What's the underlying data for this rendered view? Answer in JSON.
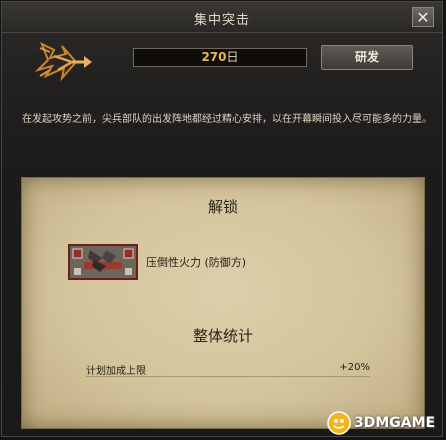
{
  "window": {
    "title": "集中突击"
  },
  "header": {
    "duration_value": "270",
    "duration_unit": "日",
    "research_label": "研发"
  },
  "description": "在发起攻势之前，尖兵部队的出发阵地都经过精心安排，以在开幕瞬间投入尽可能多的力量。",
  "unlock": {
    "title": "解锁",
    "item_label": "压倒性火力 (防御方)"
  },
  "stats": {
    "title": "整体统计",
    "rows": [
      {
        "label": "计划加成上限",
        "value": "+20%"
      }
    ]
  },
  "watermark": {
    "text": "3DMGAME"
  },
  "icons": {
    "close": "close-icon",
    "emblem": "arrow-emblem-icon",
    "unlock": "tank-unit-icon",
    "watermark": "3dm-logo-icon"
  },
  "colors": {
    "accent_number": "#e8b84a",
    "parchment": "#d4c49c",
    "card_border": "#6d1f1a"
  }
}
